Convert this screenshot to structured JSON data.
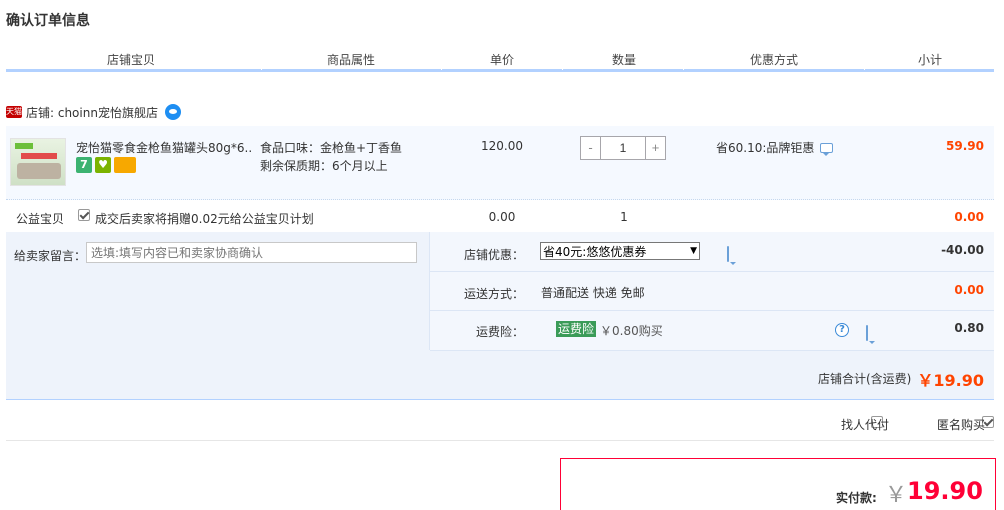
{
  "title": "确认订单信息",
  "columns": [
    "店铺宝贝",
    "商品属性",
    "单价",
    "数量",
    "优惠方式",
    "小计"
  ],
  "shop": {
    "badge": "天猫",
    "name": "店铺: choinn宠怡旗舰店"
  },
  "item": {
    "title": "宠怡猫零食金枪鱼猫罐头80g*6...",
    "badges": [
      "7",
      "♥"
    ],
    "flavor": "食品口味：金枪鱼+丁香鱼",
    "shelf_life": "剩余保质期：6个月以上",
    "unit_price": "120.00",
    "qty": {
      "minus": "-",
      "value": "1",
      "plus": "+"
    },
    "discount": "省60.10:品牌钜惠",
    "subtotal": "59.90"
  },
  "welfare": {
    "label": "公益宝贝",
    "text": "成交后卖家将捐赠0.02元给公益宝贝计划",
    "price": "0.00",
    "qty": "1",
    "subtotal": "0.00",
    "checked": true
  },
  "memo": {
    "label": "给卖家留言：",
    "placeholder": "选填:填写内容已和卖家协商确认"
  },
  "shop_discount": {
    "label": "店铺优惠：",
    "selected": "省40元:悠悠优惠券",
    "value": "-40.00"
  },
  "shipping": {
    "label": "运送方式：",
    "method": "普通配送 快递 免邮",
    "value": "0.00"
  },
  "insurance": {
    "label": "运费险：",
    "tag": "运费险",
    "price": "￥0.80购买",
    "value": "0.80",
    "help": "?"
  },
  "shop_total": {
    "label": "店铺合计(含运费)",
    "value": "￥19.90"
  },
  "options": {
    "proxy": "找人代付",
    "anonymous": "匿名购买",
    "anonymous_checked": true,
    "proxy_checked": false
  },
  "payment": {
    "label": "实付款:",
    "currency": "￥",
    "value": "19.90"
  },
  "colors": {
    "accent": "#ff0036",
    "price": "#ff4400",
    "header_border": "#b2d1ff",
    "panel_bg": "#eef3fb"
  }
}
